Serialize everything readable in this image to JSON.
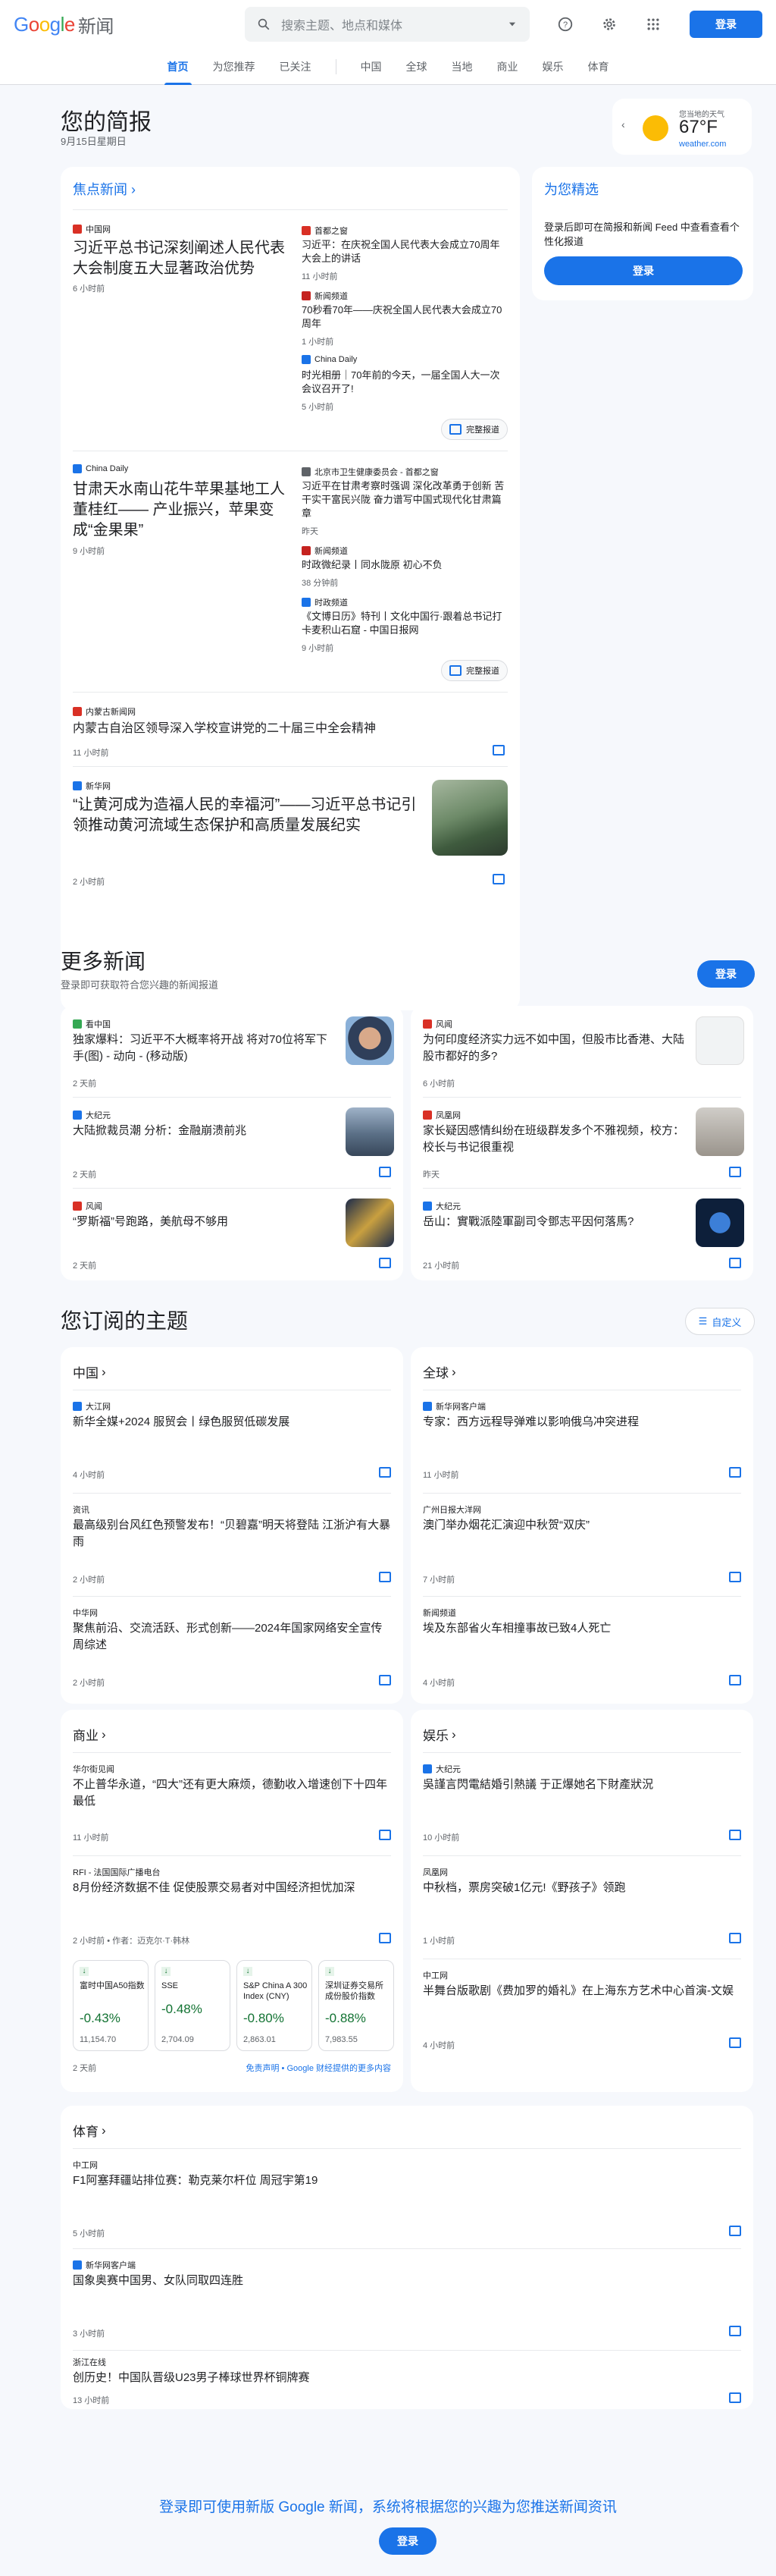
{
  "header": {
    "logo": {
      "g": "G",
      "o1": "o",
      "o2": "o",
      "g2": "g",
      "l": "l",
      "e": "e",
      "news": "新闻"
    },
    "search_placeholder": "搜索主题、地点和媒体",
    "login": "登录"
  },
  "nav": {
    "items": [
      "首页",
      "为您推荐",
      "已关注",
      "中国",
      "全球",
      "当地",
      "商业",
      "娱乐",
      "体育"
    ]
  },
  "briefing": {
    "title": "您的简报",
    "date": "9月15日星期日"
  },
  "weather": {
    "label": "您当地的天气",
    "temp": "67°F",
    "source": "weather.com"
  },
  "top": {
    "title": "焦点新闻",
    "clusters": [
      {
        "main": {
          "source": "中国网",
          "title": "习近平总书记深刻阐述人民代表大会制度五大显著政治优势",
          "time": "6 小时前"
        },
        "side": [
          {
            "source": "首都之窗",
            "title": "习近平：在庆祝全国人民代表大会成立70周年大会上的讲话",
            "time": "11 小时前"
          },
          {
            "source": "新闻频道",
            "title": "70秒看70年——庆祝全国人民代表大会成立70周年",
            "time": "1 小时前"
          },
          {
            "source": "China Daily",
            "title": "时光相册｜70年前的今天，一届全国人大一次会议召开了!",
            "time": "5 小时前"
          }
        ],
        "full": "完整报道"
      },
      {
        "main": {
          "source": "China Daily",
          "title": "甘肃天水南山花牛苹果基地工人董桂红—— 产业振兴，苹果变成“金果果”",
          "time": "9 小时前"
        },
        "side": [
          {
            "source": "北京市卫生健康委员会 - 首都之窗",
            "title": "习近平在甘肃考察时强调 深化改革勇于创新 苦干实干富民兴陇 奋力谱写中国式现代化甘肃篇章",
            "time": "昨天"
          },
          {
            "source": "新闻频道",
            "title": "时政微纪录丨同水陇原 初心不负",
            "time": "38 分钟前"
          },
          {
            "source": "时政频道",
            "title": "《文博日历》特刊丨文化中国行·跟着总书记打卡麦积山石窟 - 中国日报网",
            "time": "9 小时前"
          }
        ],
        "full": "完整报道"
      }
    ],
    "single1": {
      "source": "内蒙古新闻网",
      "title": "内蒙古自治区领导深入学校宣讲党的二十届三中全会精神",
      "time": "11 小时前"
    },
    "single2": {
      "source": "新华网",
      "title": "“让黄河成为造福人民的幸福河”——习近平总书记引领推动黄河流域生态保护和高质量发展纪实",
      "time": "2 小时前"
    }
  },
  "picks": {
    "title": "为您精选",
    "text": "登录后即可在简报和新闻 Feed 中查看查看个性化报道",
    "login": "登录"
  },
  "more": {
    "title": "更多新闻",
    "sub": "登录即可获取符合您兴趣的新闻报道",
    "login": "登录",
    "items": [
      {
        "source": "看中国",
        "title": "独家爆料：习近平不大概率将开战 将对70位将军下手(图) - 动向 - (移动版)",
        "time": "2 天前"
      },
      {
        "source": "风闻",
        "title": "为何印度经济实力远不如中国，但股市比香港、大陆股市都好的多?",
        "time": "6 小时前"
      },
      {
        "source": "大纪元",
        "title": "大陆掀裁员潮 分析：金融崩溃前兆",
        "time": "2 天前"
      },
      {
        "source": "凤凰网",
        "title": "家长疑因感情纠纷在班级群发多个不雅视频，校方：校长与书记很重视",
        "time": "昨天"
      },
      {
        "source": "风闻",
        "title": "“罗斯福”号跑路，美航母不够用",
        "time": "2 天前"
      },
      {
        "source": "大纪元",
        "title": "岳山：實戰派陸軍副司令鄧志平因何落馬?",
        "time": "21 小时前"
      }
    ]
  },
  "topics": {
    "title": "您订阅的主题",
    "customize": "自定义",
    "china": {
      "title": "中国",
      "items": [
        {
          "source": "大江网",
          "title": "新华全媒+2024 服贸会丨绿色服贸低碳发展",
          "time": "4 小时前"
        },
        {
          "source": "资讯",
          "title": "最高级别台风红色预警发布！“贝碧嘉”明天将登陆 江浙沪有大暴雨",
          "time": "2 小时前"
        },
        {
          "source": "中华网",
          "title": "聚焦前沿、交流活跃、形式创新——2024年国家网络安全宣传周综述",
          "time": "2 小时前"
        }
      ]
    },
    "world": {
      "title": "全球",
      "items": [
        {
          "source": "新华网客户端",
          "title": "专家：西方远程导弹难以影响俄乌冲突进程",
          "time": "11 小时前"
        },
        {
          "source": "广州日报大洋网",
          "title": "澳门举办烟花汇演迎中秋贺“双庆”",
          "time": "7 小时前"
        },
        {
          "source": "新闻频道",
          "title": "埃及东部省火车相撞事故已致4人死亡",
          "time": "4 小时前"
        }
      ]
    },
    "business": {
      "title": "商业",
      "items": [
        {
          "source": "华尔街见闻",
          "title": "不止普华永道，“四大”还有更大麻烦，德勤收入增速创下十四年最低",
          "time": "11 小时前"
        },
        {
          "source": "RFI - 法国国际广播电台",
          "title": "8月份经济数据不佳 促使股票交易者对中国经济担忧加深",
          "time": "2 小时前 • 作者：迈克尔·T·韩林"
        }
      ],
      "stocks": [
        {
          "name": "富时中国A50指数",
          "change": "-0.43%",
          "value": "11,154.70"
        },
        {
          "name": "SSE",
          "change": "-0.48%",
          "value": "2,704.09"
        },
        {
          "name": "S&P China A 300 Index (CNY)",
          "change": "-0.80%",
          "value": "2,863.01"
        },
        {
          "name": "深圳证券交易所成份股价指数",
          "change": "-0.88%",
          "value": "7,983.55"
        }
      ],
      "time": "2 天前",
      "disclaimer": "免责声明 • Google 财经提供的更多内容"
    },
    "ent": {
      "title": "娱乐",
      "items": [
        {
          "source": "大纪元",
          "title": "吳謹言閃電結婚引熱議 于正爆她名下財產狀況",
          "time": "10 小时前"
        },
        {
          "source": "凤凰网",
          "title": "中秋档，票房突破1亿元!《野孩子》领跑",
          "time": "1 小时前"
        },
        {
          "source": "中工网",
          "title": "半舞台版歌剧《费加罗的婚礼》在上海东方艺术中心首演-文娱",
          "time": "4 小时前"
        }
      ]
    },
    "sports": {
      "title": "体育",
      "items": [
        {
          "source": "中工网",
          "title": "F1阿塞拜疆站排位赛：勒克莱尔杆位 周冠宇第19",
          "time": "5 小时前"
        },
        {
          "source": "新华网客户端",
          "title": "国象奥赛中国男、女队同取四连胜",
          "time": "3 小时前"
        },
        {
          "source": "浙江在线",
          "title": "创历史！中国队晋级U23男子棒球世界杯铜牌赛",
          "time": "13 小时前"
        }
      ]
    }
  },
  "footer": {
    "text": "登录即可使用新版 Google 新闻，系统将根据您的兴趣为您推送新闻资讯",
    "login": "登录"
  },
  "colors": {
    "accent": "#1a73e8",
    "negative": "#137333",
    "bg": "#f6f8fc"
  }
}
